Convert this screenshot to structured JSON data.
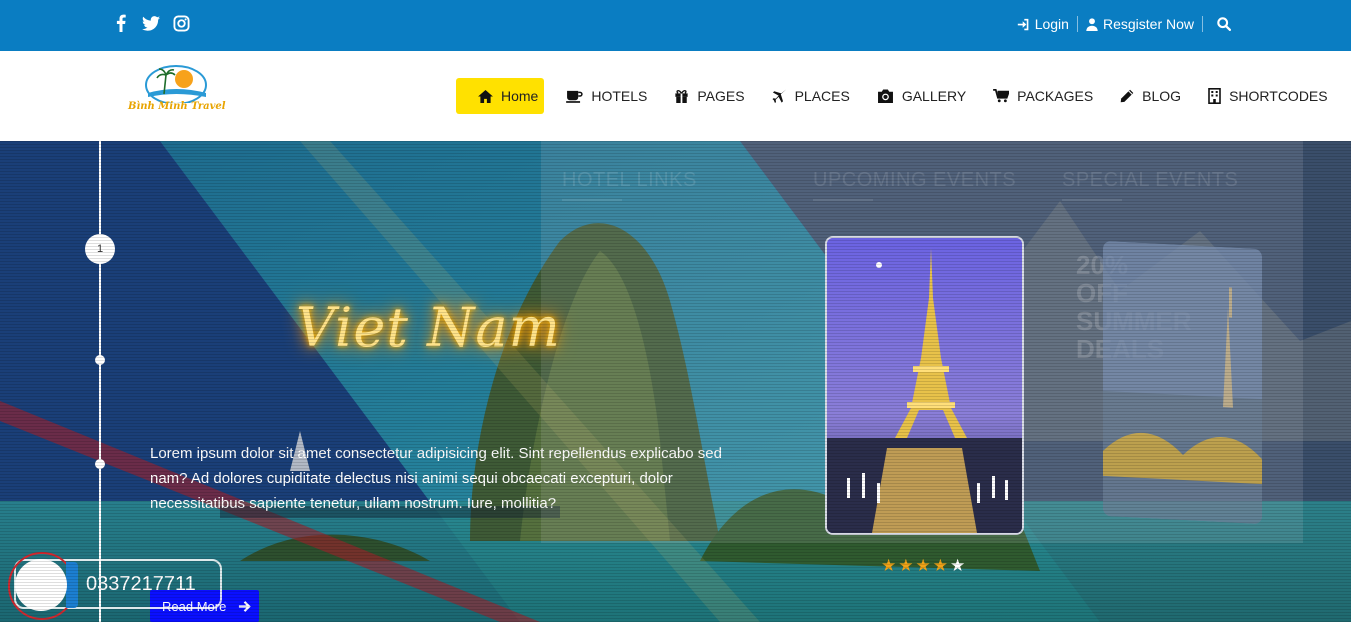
{
  "topbar": {
    "social": [
      "facebook-icon",
      "twitter-icon",
      "instagram-icon"
    ],
    "login_label": "Login",
    "register_label": "Resgister Now",
    "search_icon": "search-icon"
  },
  "logo": {
    "text": "Bình Minh Travel"
  },
  "menu": {
    "items": [
      {
        "label": "Home",
        "icon": "home-icon",
        "active": true
      },
      {
        "label": "HOTELS",
        "icon": "coffee-icon"
      },
      {
        "label": "PAGES",
        "icon": "gift-icon"
      },
      {
        "label": "PLACES",
        "icon": "plane-icon"
      },
      {
        "label": "GALLERY",
        "icon": "camera-icon"
      },
      {
        "label": "PACKAGES",
        "icon": "cart-icon"
      },
      {
        "label": "BLOG",
        "icon": "pencil-icon"
      },
      {
        "label": "SHORTCODES",
        "icon": "building-icon"
      }
    ]
  },
  "hero": {
    "step": "1",
    "title": "Viet Nam",
    "description": "Lorem ipsum dolor sit amet consectetur adipisicing elit. Sint repellendus explicabo sed nam? Ad dolores cupiditate delectus nisi animi sequi obcaecati excepturi, dolor necessitatibus sapiente tenetur, ullam nostrum. Iure, mollitia?",
    "read_more": "Read More",
    "rating": 4,
    "rating_max": 5
  },
  "overlay": {
    "headings": [
      "HOTEL LINKS",
      "UPCOMING EVENTS",
      "SPECIAL EVENTS"
    ],
    "ghost_promo": "20% OFF SUMMER DEALS"
  },
  "contact": {
    "phone": "0337217711"
  },
  "colors": {
    "topbar": "#0a7dc2",
    "active_menu": "#ffe100",
    "read_more": "#0a10ff",
    "star": "#f0a318"
  }
}
